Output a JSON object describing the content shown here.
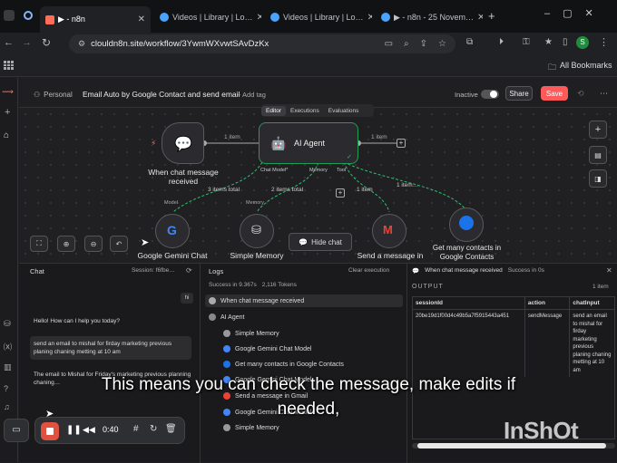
{
  "browser": {
    "tabs": [
      {
        "label": "▶ - n8n",
        "active": true
      },
      {
        "label": "Videos | Library | Lo…"
      },
      {
        "label": "Videos | Library | Lo…"
      },
      {
        "label": "▶ - n8n - 25 Novem…"
      }
    ],
    "url": "clouldn8n.site/workflow/3YwmWXvwtSAvDzKx",
    "bookmarks_label": "All Bookmarks",
    "profile_initial": "S"
  },
  "header": {
    "breadcrumb": "Personal",
    "workflow_name": "Email Auto by Google Contact and send email",
    "add_tag": "+ Add tag",
    "status": "Inactive",
    "share": "Share",
    "save": "Save",
    "tabs": [
      "Editor",
      "Executions",
      "Evaluations"
    ]
  },
  "canvas": {
    "trigger_label": "When chat message received",
    "agent_label": "AI Agent",
    "edge_item_1": "1 item",
    "edge_item_2": "1 item",
    "port_chat_model": "Chat Model*",
    "port_memory": "Memory",
    "port_tool": "Tool",
    "edge_gemini": "3 items total",
    "edge_memory": "2 items total",
    "edge_gmail": "1 item",
    "edge_contacts": "1 item…",
    "sub_model_tag": "Model",
    "sub_memory_tag": "Memory",
    "gemini_label": "Google Gemini Chat",
    "memory_label": "Simple Memory",
    "gmail_label": "Send a message in",
    "contacts_label": "Get many contacts in Google Contacts",
    "hide_chat": "Hide chat"
  },
  "chat": {
    "title": "Chat",
    "session": "Session: f6fbe…",
    "user_initial": "hi",
    "messages": [
      "Hello! How can I help you today?",
      "send an email to mishal for firday marketing previous planing chaning metting at 10 am",
      "The email to Mishal for Friday's marketing previous planning chaning…"
    ]
  },
  "logs": {
    "title": "Logs",
    "clear": "Clear execution",
    "stats": [
      "Success in 9.367s",
      "2,116 Tokens"
    ],
    "items": [
      "When chat message received",
      "AI Agent",
      "Simple Memory",
      "Google Gemini Chat Model",
      "Get many contacts in Google Contacts",
      "Google Gemini Chat Model",
      "Send a message in Gmail",
      "Google Gemini Chat Model",
      "Simple Memory"
    ]
  },
  "output": {
    "node_title": "When chat message received",
    "success": "Success in 0s",
    "section": "OUTPUT",
    "items": "1 item",
    "columns": [
      "sessionId",
      "action",
      "chatInput"
    ],
    "row": {
      "sessionId": "20be19d1f00d4c49b5a7f5915443a451",
      "action": "sendMessage",
      "chatInput": "send an email to mishal for firday marketing previous planing chaning metting at 10 am"
    }
  },
  "recorder": {
    "time": "0:40"
  },
  "caption": {
    "line1": "This means you can check the message, make edits if",
    "line2": "needed,"
  },
  "watermark": "InShOt",
  "colors": {
    "accent": "#ff6d5a",
    "node_border_success": "#1f9d55",
    "save": "#ff5a5a"
  }
}
